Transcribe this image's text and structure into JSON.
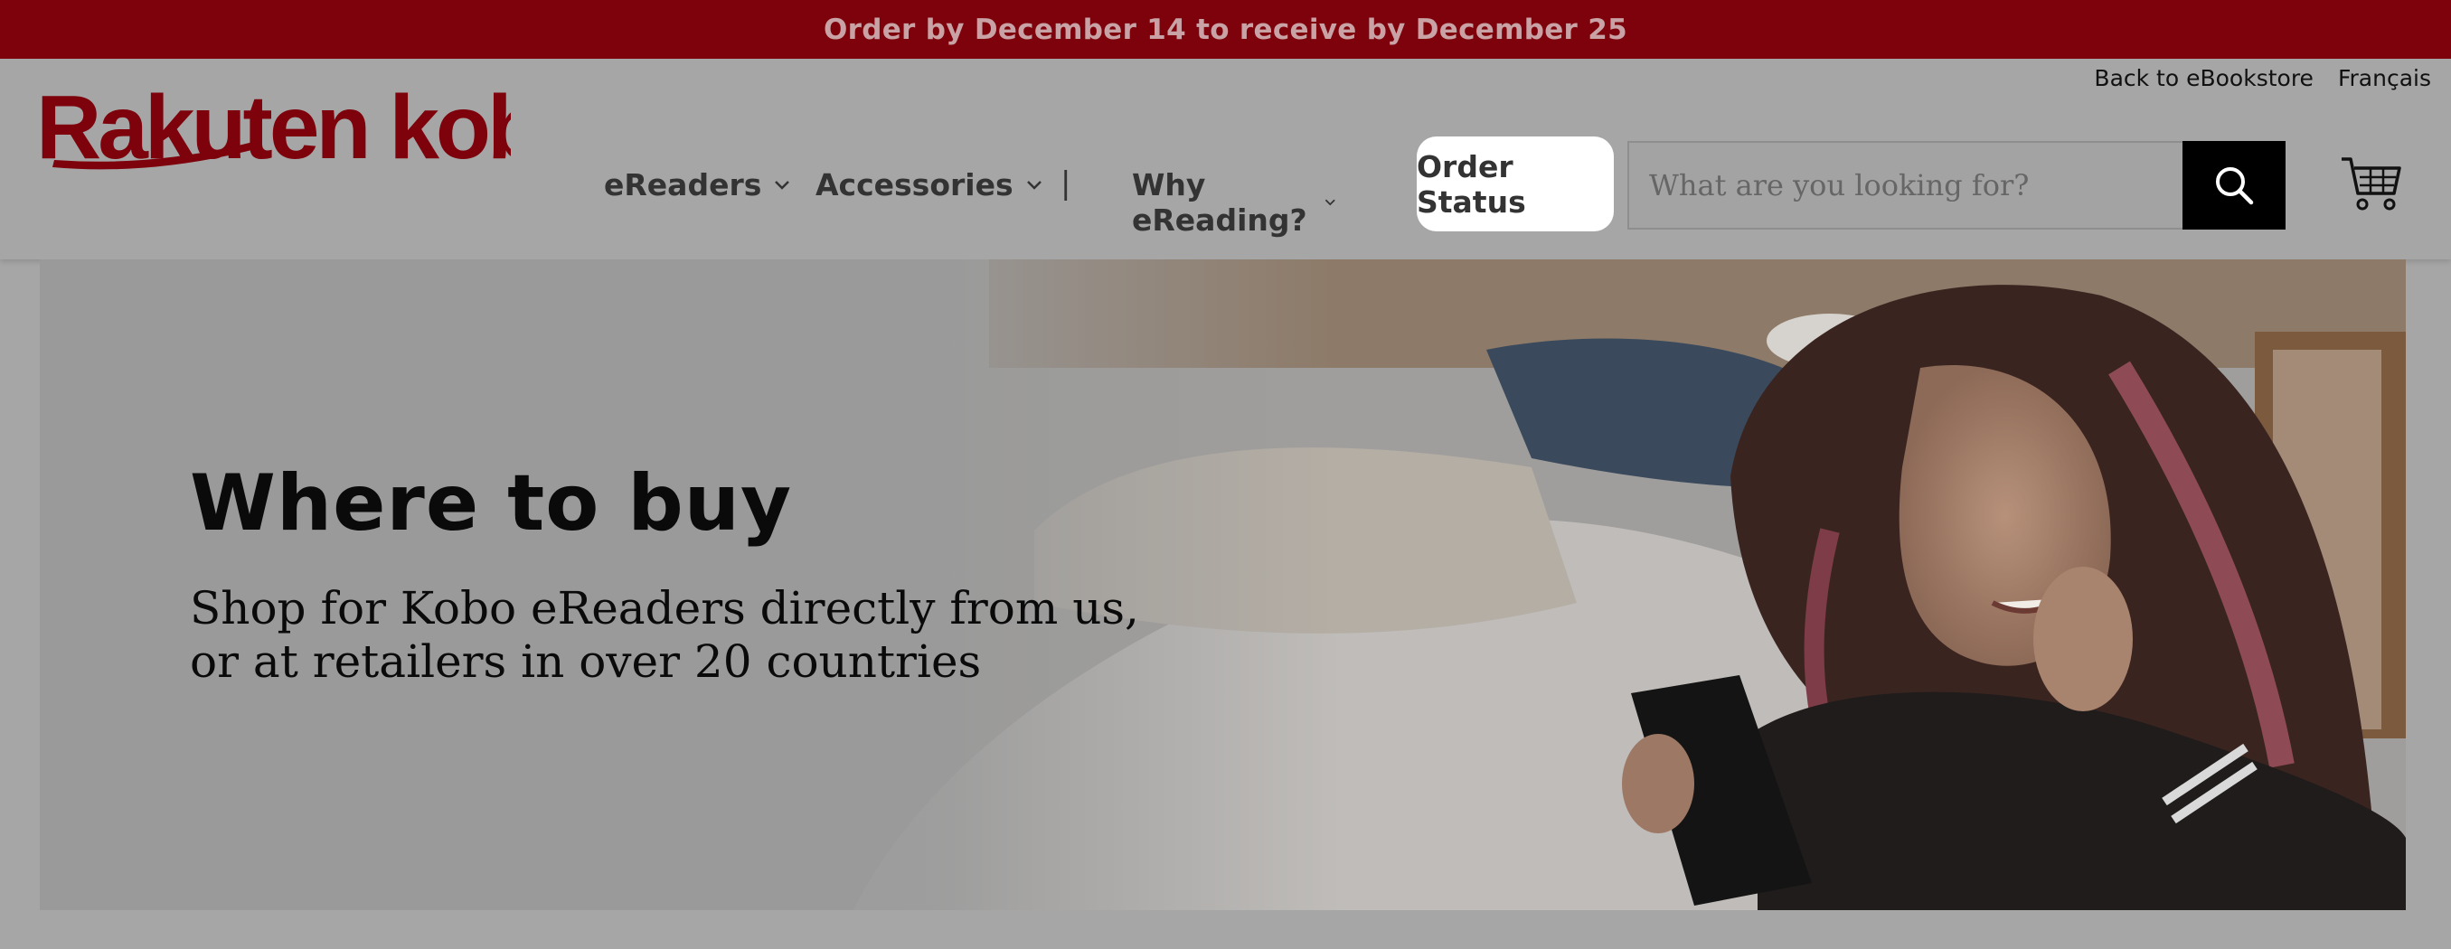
{
  "promo": {
    "text": "Order by December 14 to receive by December 25"
  },
  "utility_nav": {
    "back_link": "Back to eBookstore",
    "language_link": "Français"
  },
  "brand": {
    "logo_text": "Rakuten kobo",
    "logo_color": "#7d020b"
  },
  "main_nav": {
    "items": [
      {
        "label": "eReaders",
        "icon": "chevron-down-icon"
      },
      {
        "label": "Accessories",
        "icon": "chevron-down-icon"
      },
      {
        "label": "Why eReading?",
        "icon": "chevron-down-icon"
      }
    ],
    "divider": "|",
    "order_status": "Order Status"
  },
  "search": {
    "placeholder": "What are you looking for?",
    "button_icon": "search-icon"
  },
  "cart": {
    "icon": "cart-icon"
  },
  "hero": {
    "title": "Where to buy",
    "subtitle": "Shop for Kobo eReaders directly from us, or at retailers in over 20 countries"
  },
  "colors": {
    "promo_bg": "#7d020b",
    "overlay_bg": "#a6a6a6",
    "search_button_bg": "#000000"
  }
}
